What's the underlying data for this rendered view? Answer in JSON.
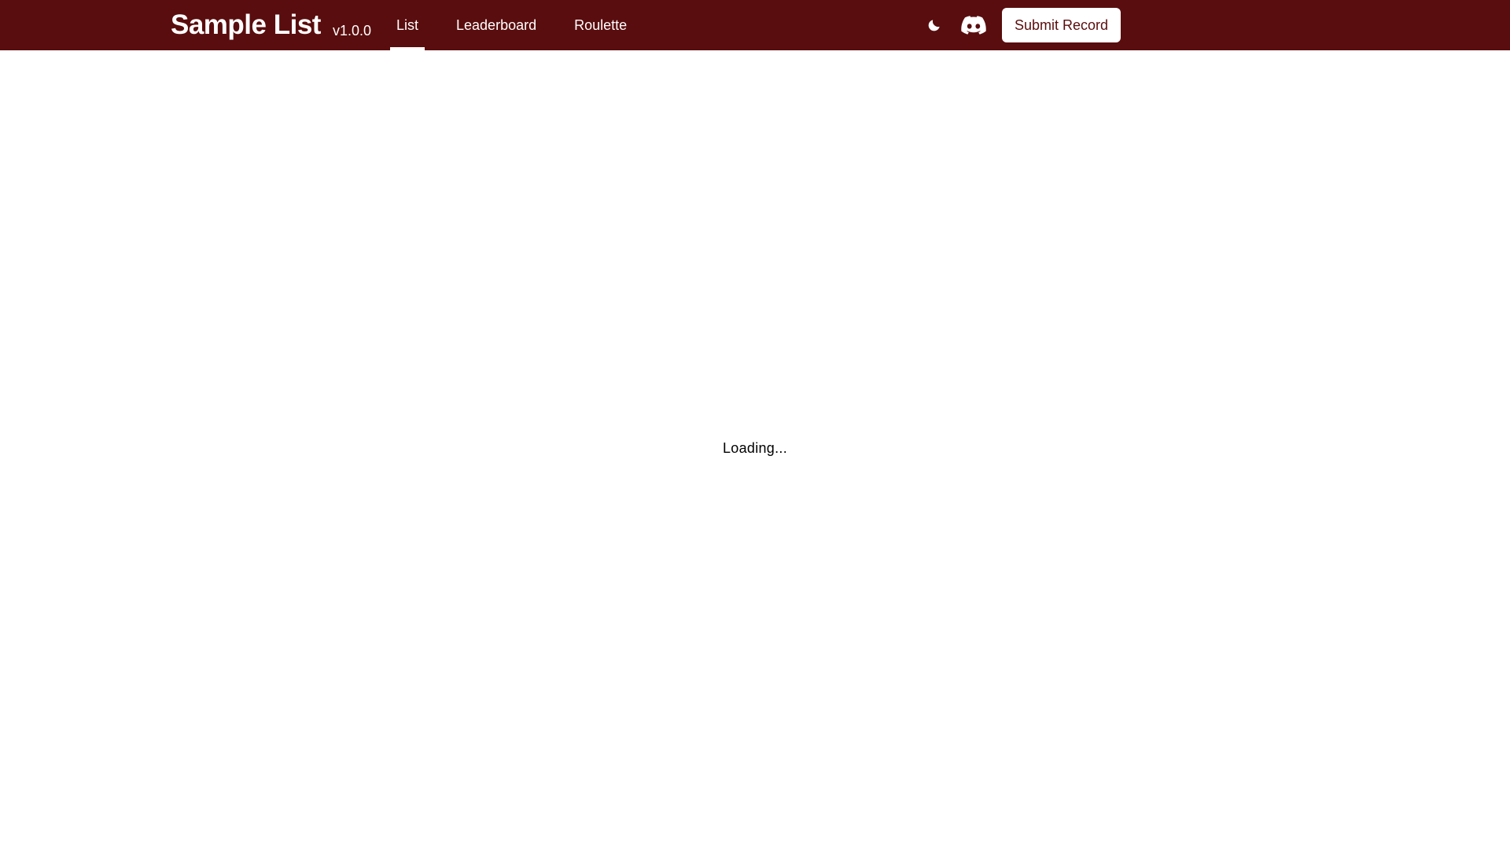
{
  "header": {
    "title": "Sample List",
    "version": "v1.0.0",
    "background_color": "#5a0d0e"
  },
  "nav": {
    "tabs": [
      {
        "label": "List",
        "active": true
      },
      {
        "label": "Leaderboard",
        "active": false
      },
      {
        "label": "Roulette",
        "active": false
      }
    ]
  },
  "toolbar": {
    "theme_icon": "moon-icon",
    "discord_icon": "discord-icon",
    "submit_label": "Submit Record"
  },
  "main": {
    "status_text": "Loading..."
  }
}
